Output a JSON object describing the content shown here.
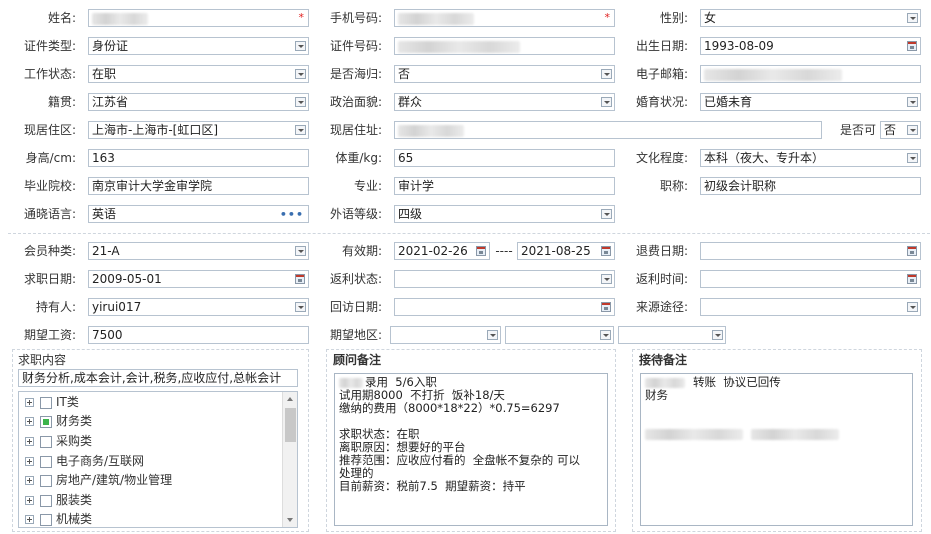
{
  "labels": {
    "name": "姓名:",
    "phone": "手机号码:",
    "gender": "性别:",
    "id_type": "证件类型:",
    "id_no": "证件号码:",
    "birth": "出生日期:",
    "work_status": "工作状态:",
    "returnee": "是否海归:",
    "email": "电子邮箱:",
    "native": "籍贯:",
    "politics": "政治面貌:",
    "marital": "婚育状况:",
    "residence": "现居住区:",
    "address": "现居住址:",
    "whether": "是否可",
    "height": "身高/cm:",
    "weight": "体重/kg:",
    "education": "文化程度:",
    "school": "毕业院校:",
    "major": "专业:",
    "title": "职称:",
    "language": "通晓语言:",
    "lang_level": "外语等级:",
    "member_type": "会员种类:",
    "valid": "有效期:",
    "refund_date": "退费日期:",
    "job_date": "求职日期:",
    "rebate_status": "返利状态:",
    "rebate_time": "返利时间:",
    "holder": "持有人:",
    "visit_date": "回访日期:",
    "source": "来源途径:",
    "salary": "期望工资:",
    "region": "期望地区:",
    "range_sep": "----"
  },
  "fields": {
    "gender": "女",
    "id_type": "身份证",
    "birth": "1993-08-09",
    "work_status": "在职",
    "returnee": "否",
    "native": "江苏省",
    "politics": "群众",
    "marital": "已婚未育",
    "residence": "上海市-上海市-[虹口区]",
    "whether": "否",
    "height": "163",
    "weight": "65",
    "education": "本科（夜大、专升本）",
    "school": "南京审计大学金审学院",
    "major": "审计学",
    "title": "初级会计职称",
    "language": "英语",
    "lang_level": "四级",
    "member_type": "21-A",
    "valid_from": "2021-02-26",
    "valid_to": "2021-08-25",
    "job_date": "2009-05-01",
    "holder": "yirui017",
    "salary": "7500"
  },
  "panels": {
    "job_content": {
      "title": "求职内容",
      "summary": "财务分析,成本会计,会计,税务,应收应付,总帐会计",
      "items": [
        {
          "label": "IT类",
          "checked": false
        },
        {
          "label": "财务类",
          "checked": true
        },
        {
          "label": "采购类",
          "checked": false
        },
        {
          "label": "电子商务/互联网",
          "checked": false
        },
        {
          "label": "房地产/建筑/物业管理",
          "checked": false
        },
        {
          "label": "服装类",
          "checked": false
        },
        {
          "label": "机械类",
          "checked": false
        }
      ]
    },
    "consultant": {
      "title": "顾问备注",
      "lines": [
        "录用  5/6入职",
        "试用期8000  不打折  饭补18/天",
        "缴纳的费用（8000*18*22）*0.75=6297",
        "",
        "求职状态：在职",
        "离职原因：想要好的平台",
        "推荐范围：应收应付看的  全盘帐不复杂的 可以",
        "处理的",
        "目前薪资：税前7.5  期望薪资：持平"
      ]
    },
    "reception": {
      "title": "接待备注",
      "line1": "转账  协议已回传",
      "line2": "财务"
    }
  }
}
